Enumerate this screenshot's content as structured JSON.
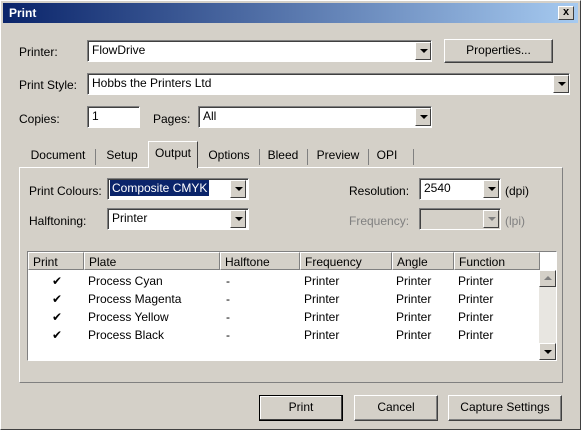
{
  "window": {
    "title": "Print",
    "close_label": "x"
  },
  "printer": {
    "label": "Printer:",
    "value": "FlowDrive",
    "properties_label": "Properties..."
  },
  "print_style": {
    "label": "Print Style:",
    "value": "Hobbs the Printers Ltd"
  },
  "copies": {
    "label": "Copies:",
    "value": "1"
  },
  "pages": {
    "label": "Pages:",
    "value": "All"
  },
  "tabs": [
    {
      "label": "Document"
    },
    {
      "label": "Setup"
    },
    {
      "label": "Output",
      "active": true
    },
    {
      "label": "Options"
    },
    {
      "label": "Bleed"
    },
    {
      "label": "Preview"
    },
    {
      "label": "OPI"
    }
  ],
  "output": {
    "print_colours": {
      "label": "Print Colours:",
      "value": "Composite CMYK"
    },
    "halftoning": {
      "label": "Halftoning:",
      "value": "Printer"
    },
    "resolution": {
      "label": "Resolution:",
      "value": "2540",
      "unit": "(dpi)"
    },
    "frequency": {
      "label": "Frequency:",
      "value": "",
      "unit": "(lpi)"
    }
  },
  "plates": {
    "columns": [
      "Print",
      "Plate",
      "Halftone",
      "Frequency",
      "Angle",
      "Function"
    ],
    "rows": [
      {
        "print": "✔",
        "plate": "Process Cyan",
        "halftone": "-",
        "frequency": "Printer",
        "angle": "Printer",
        "function": "Printer"
      },
      {
        "print": "✔",
        "plate": "Process Magenta",
        "halftone": "-",
        "frequency": "Printer",
        "angle": "Printer",
        "function": "Printer"
      },
      {
        "print": "✔",
        "plate": "Process Yellow",
        "halftone": "-",
        "frequency": "Printer",
        "angle": "Printer",
        "function": "Printer"
      },
      {
        "print": "✔",
        "plate": "Process Black",
        "halftone": "-",
        "frequency": "Printer",
        "angle": "Printer",
        "function": "Printer"
      }
    ]
  },
  "buttons": {
    "print": "Print",
    "cancel": "Cancel",
    "capture": "Capture Settings"
  },
  "colors": {
    "title_start": "#0a246a",
    "title_end": "#a6caf0",
    "selection": "#0a246a",
    "face": "#d4d0c8"
  }
}
